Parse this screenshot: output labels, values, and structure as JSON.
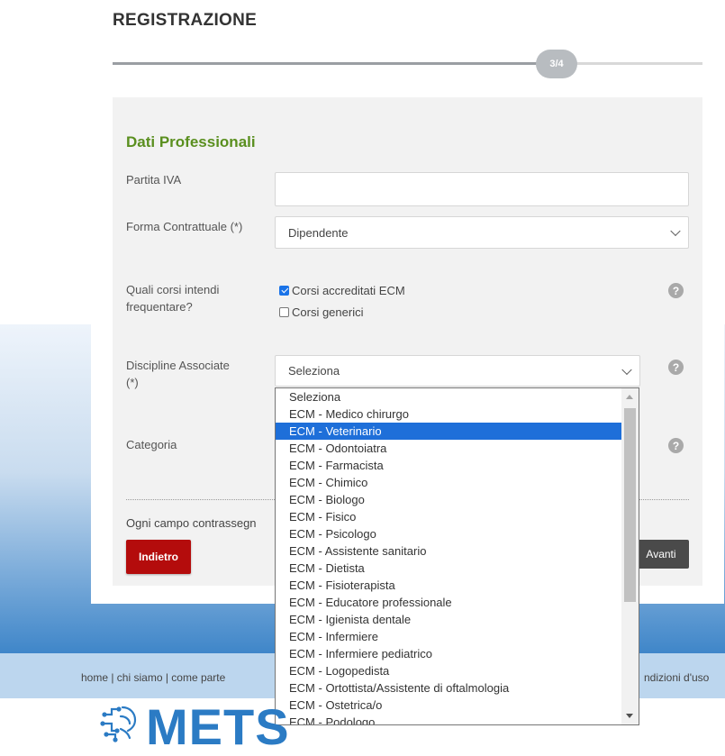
{
  "page": {
    "title": "REGISTRAZIONE",
    "step": "3/4",
    "progress_fraction": 0.75
  },
  "form": {
    "section_title": "Dati Professionali",
    "partita_iva": {
      "label": "Partita IVA",
      "value": ""
    },
    "forma_contrattuale": {
      "label": "Forma Contrattuale (*)",
      "value": "Dipendente"
    },
    "corsi": {
      "label": "Quali corsi intendi frequentare?",
      "options": [
        {
          "label": "Corsi accreditati ECM",
          "checked": true
        },
        {
          "label": "Corsi generici",
          "checked": false
        }
      ]
    },
    "discipline": {
      "label": "Discipline Associate (*)",
      "value": "Seleziona"
    },
    "categoria": {
      "label": "Categoria"
    },
    "note": "Ogni campo contrassegn",
    "back_label": "Indietro",
    "next_label": "Avanti",
    "help_icon": "?"
  },
  "dropdown": {
    "selected_index": 2,
    "options": [
      "Seleziona",
      "ECM - Medico chirurgo",
      "ECM - Veterinario",
      "ECM - Odontoiatra",
      "ECM - Farmacista",
      "ECM - Chimico",
      "ECM - Biologo",
      "ECM - Fisico",
      "ECM - Psicologo",
      "ECM - Assistente sanitario",
      "ECM - Dietista",
      "ECM - Fisioterapista",
      "ECM - Educatore professionale",
      "ECM - Igienista dentale",
      "ECM - Infermiere",
      "ECM - Infermiere pediatrico",
      "ECM - Logopedista",
      "ECM - Ortottista/Assistente di oftalmologia",
      "ECM - Ostetrica/o",
      "ECM - Podologo"
    ]
  },
  "footer": {
    "links_left": "home | chi siamo | come parte",
    "links_right": "ndizioni d'uso"
  },
  "logo": {
    "text": "METS"
  },
  "colors": {
    "accent_green": "#5a8f1f",
    "back_button": "#b40c0c",
    "selected_option": "#1e6fd9",
    "brand_blue": "#2b7bc4"
  }
}
